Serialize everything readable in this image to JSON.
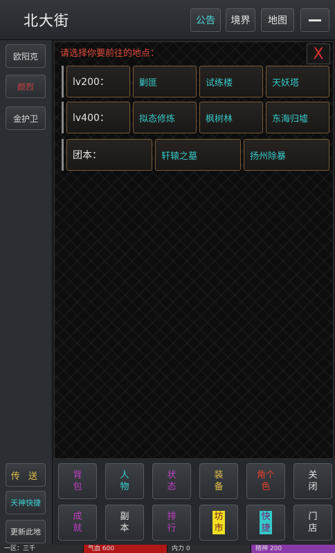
{
  "header": {
    "location": "北大街",
    "notice_label": "公告",
    "realm_label": "境界",
    "map_label": "地图"
  },
  "sidebar": {
    "npcs": [
      "欧阳克",
      "颜烈",
      "金护卫"
    ],
    "teleport_label": "传 送",
    "quick_label": "天神快捷",
    "refresh_label": "更新此地"
  },
  "main": {
    "prompt": "请选择你要前往的地点：",
    "close_glyph": "X",
    "rows": [
      {
        "label": "lv200：",
        "destinations": [
          "剿匪",
          "试练楼",
          "天妖塔"
        ]
      },
      {
        "label": "lv400：",
        "destinations": [
          "拟态修炼",
          "枫树林",
          "东海归墟"
        ]
      },
      {
        "label": "团本：",
        "destinations": [
          "轩辕之墓",
          "扬州除暴"
        ]
      }
    ]
  },
  "actions": {
    "row1": [
      {
        "label": "背\n包",
        "color": "#c040c0"
      },
      {
        "label": "人\n物",
        "color": "#3ad0d0"
      },
      {
        "label": "状\n态",
        "color": "#c040c0"
      },
      {
        "label": "装\n备",
        "color": "#e4c04a"
      },
      {
        "label": "角个\n色",
        "color": "#e04030"
      },
      {
        "label": "关\n闭",
        "color": "#e6e6e6"
      }
    ],
    "row2": [
      {
        "label": "成\n就",
        "color": "#c040c0"
      },
      {
        "label": "副\n本",
        "color": "#e6e6e6"
      },
      {
        "label": "排\n行",
        "color": "#c040c0"
      },
      {
        "label": "坊\n市",
        "color": "#7a2020"
      },
      {
        "label": "快\n捷",
        "color": "#7a2070"
      },
      {
        "label": "门\n店",
        "color": "#e6e6e6"
      }
    ]
  },
  "status": {
    "server": "一区：三千",
    "hp": "气血 600",
    "power": "内力 0",
    "spirit": "精神 200"
  }
}
